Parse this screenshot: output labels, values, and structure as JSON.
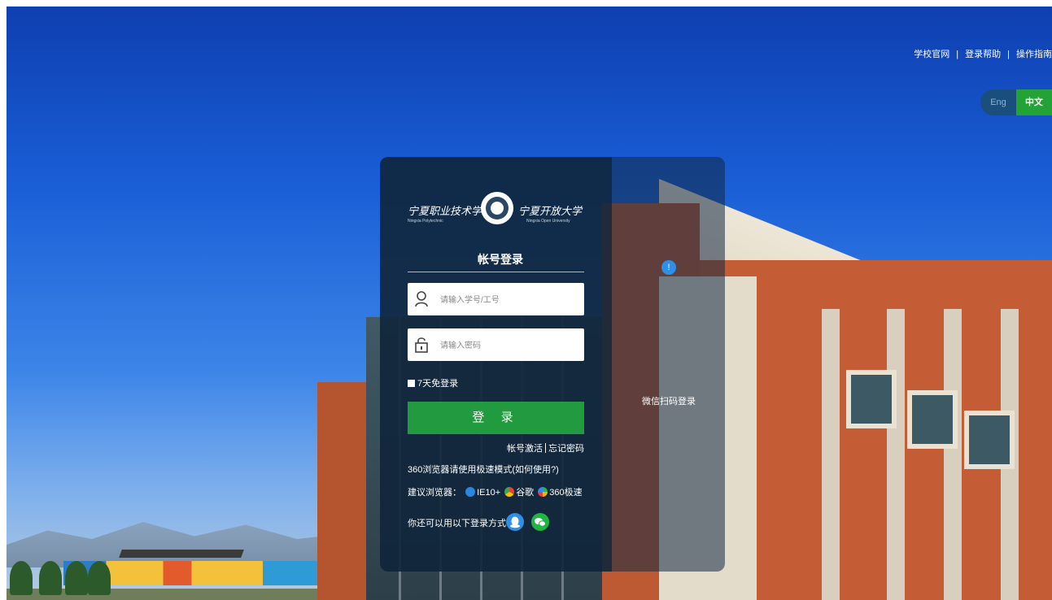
{
  "top_links": {
    "site": "学校官网",
    "help": "登录帮助",
    "guide": "操作指南"
  },
  "lang": {
    "en": "Eng",
    "cn": "中文"
  },
  "logo": {
    "school1_cn": "宁夏职业技术学院",
    "school1_en": "Ningxia Polytechnic",
    "school2_cn": "宁夏开放大学",
    "school2_en": "Ningxia Open University"
  },
  "login": {
    "title": "帐号登录",
    "username_placeholder": "请输入学号/工号",
    "password_placeholder": "请输入密码",
    "remember": "7天免登录",
    "submit": "登 录",
    "activate": "帐号激活",
    "forgot": "忘记密码",
    "tip_360": "360浏览器请使用极速模式(如何使用?)",
    "browsers_label": "建议浏览器：",
    "browser_ie": "IE10+",
    "browser_chrome": "谷歌",
    "browser_360": "360极速",
    "other_label": "你还可以用以下登录方式："
  },
  "wechat": {
    "label": "微信扫码登录"
  },
  "colors": {
    "accent_green": "#229a3f",
    "panel_bg": "#10253a",
    "qq_blue": "#2f8ee6",
    "wechat_green": "#22b345"
  },
  "icons": {
    "user": "user-icon",
    "lock": "lock-icon",
    "qq": "qq-icon",
    "wechat": "wechat-icon"
  }
}
